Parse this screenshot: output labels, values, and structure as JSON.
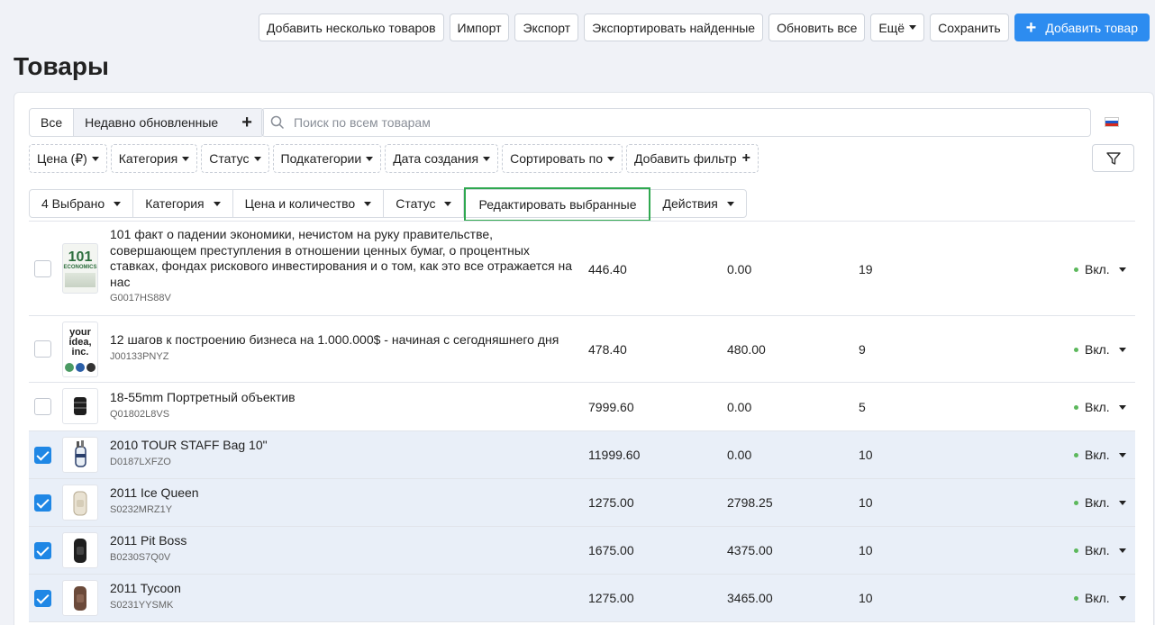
{
  "toolbar": {
    "add_multiple": "Добавить несколько товаров",
    "import": "Импорт",
    "export": "Экспорт",
    "export_found": "Экспортировать найденные",
    "update_all": "Обновить все",
    "more": "Ещё",
    "save": "Сохранить",
    "add_product": "Добавить товар"
  },
  "page_title": "Товары",
  "tabs": {
    "all": "Все",
    "recent": "Недавно обновленные",
    "add": "+"
  },
  "search": {
    "placeholder": "Поиск по всем товарам"
  },
  "filters": [
    "Цена (₽)",
    "Категория",
    "Статус",
    "Подкатегории",
    "Дата создания",
    "Сортировать по"
  ],
  "add_filter": "Добавить фильтр",
  "bulk": {
    "selected": "4 Выбрано",
    "category": "Категория",
    "price_qty": "Цена и количество",
    "status": "Статус",
    "edit_selected": "Редактировать выбранные",
    "actions": "Действия"
  },
  "rows": [
    {
      "name": "101 факт о падении экономики, нечистом на руку правительстве, совершающем преступления в отношении ценных бумаг, о процентных ставках, фондах рискового инвестирования и о том, как это все отражается на нас",
      "sku": "G0017HS88V",
      "price": "446.40",
      "list_price": "0.00",
      "qty": "19",
      "status": "Вкл.",
      "checked": false
    },
    {
      "name": "12 шагов к построению бизнеса на 1.000.000$ - начиная с сегодняшнего дня",
      "sku": "J00133PNYZ",
      "price": "478.40",
      "list_price": "480.00",
      "qty": "9",
      "status": "Вкл.",
      "checked": false
    },
    {
      "name": "18-55mm Портретный объектив",
      "sku": "Q01802L8VS",
      "price": "7999.60",
      "list_price": "0.00",
      "qty": "5",
      "status": "Вкл.",
      "checked": false
    },
    {
      "name": "2010 TOUR STAFF Bag 10\"",
      "sku": "D0187LXFZO",
      "price": "11999.60",
      "list_price": "0.00",
      "qty": "10",
      "status": "Вкл.",
      "checked": true
    },
    {
      "name": "2011 Ice Queen",
      "sku": "S0232MRZ1Y",
      "price": "1275.00",
      "list_price": "2798.25",
      "qty": "10",
      "status": "Вкл.",
      "checked": true
    },
    {
      "name": "2011 Pit Boss",
      "sku": "B0230S7Q0V",
      "price": "1675.00",
      "list_price": "4375.00",
      "qty": "10",
      "status": "Вкл.",
      "checked": true
    },
    {
      "name": "2011 Tycoon",
      "sku": "S0231YYSMK",
      "price": "1275.00",
      "list_price": "3465.00",
      "qty": "10",
      "status": "Вкл.",
      "checked": true
    }
  ],
  "thumb_text": {
    "book1_line1": "101",
    "book1_line2": "ECONOMICS",
    "book2": "your idea, inc."
  },
  "colors": {
    "accent": "#2d8cf0",
    "checkbox": "#1f87e5",
    "highlight": "#2fa84f",
    "status_dot": "#5cb85c",
    "selected_row": "#e9eff8"
  }
}
